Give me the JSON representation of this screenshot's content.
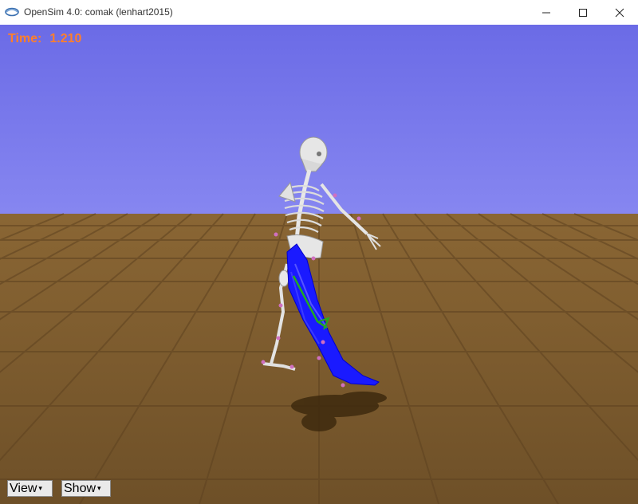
{
  "window": {
    "title": "OpenSim 4.0: comak (lenhart2015)"
  },
  "controls": {
    "minimize": "minimize",
    "maximize": "maximize",
    "close": "close"
  },
  "viewer": {
    "time_label": "Time:",
    "time_value": "1.210"
  },
  "menus": {
    "view_label": "View",
    "show_label": "Show",
    "dropdown_arrow": "▾"
  },
  "colors": {
    "sky": "#8a8af2",
    "floor": "#7a5a2e",
    "time_text": "#ff7f2a",
    "muscle": "#1a1aff",
    "ligament": "#22aa22"
  }
}
